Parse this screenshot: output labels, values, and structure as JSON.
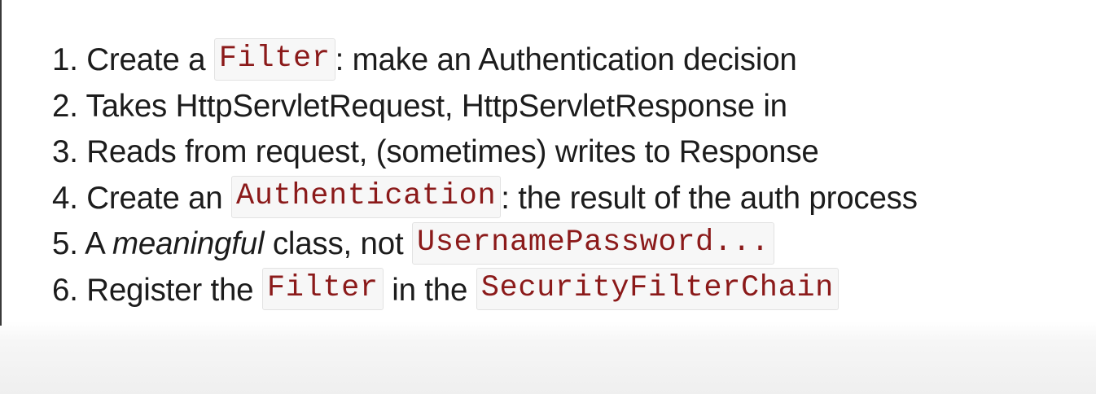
{
  "steps": [
    {
      "num": "1.",
      "t1": "Create a",
      "code1": "Filter",
      "t2": ": make an Authentication decision"
    },
    {
      "num": "2.",
      "t1": "Takes HttpServletRequest, HttpServletResponse in"
    },
    {
      "num": "3.",
      "t1": "Reads from request, (sometimes) writes to Response"
    },
    {
      "num": "4.",
      "t1": "Create an",
      "code1": "Authentication",
      "t2": ": the result of the auth process"
    },
    {
      "num": "5.",
      "t1": "A",
      "em": "meaningful",
      "t2": "class, not",
      "code1": "UsernamePassword..."
    },
    {
      "num": "6.",
      "t1": "Register the",
      "code1": "Filter",
      "t2": "in the",
      "code2": "SecurityFilterChain"
    }
  ]
}
